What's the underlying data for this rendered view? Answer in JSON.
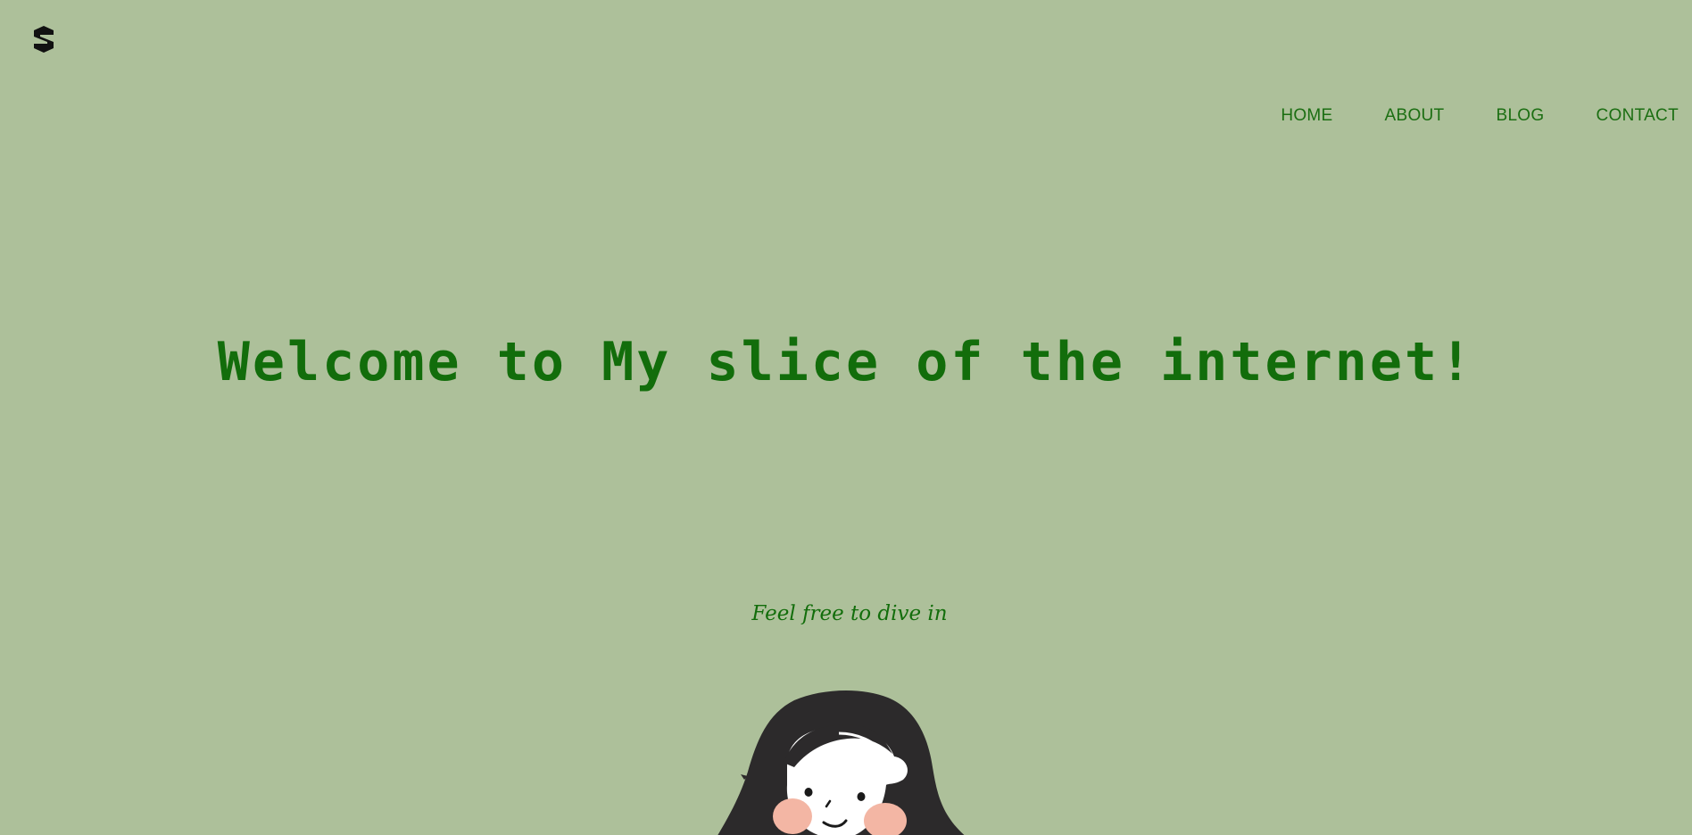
{
  "brand": {
    "logo_icon": "s-shield-logo-icon"
  },
  "nav": {
    "items": [
      {
        "label": "HOME"
      },
      {
        "label": "ABOUT"
      },
      {
        "label": "BLOG"
      },
      {
        "label": "CONTACT"
      }
    ]
  },
  "hero": {
    "title": "Welcome to My slice of the internet!",
    "subtitle": "Feel free to dive in"
  },
  "illustration": {
    "icon": "girl-portrait-illustration"
  },
  "colors": {
    "background": "#adc09a",
    "accent": "#126d0b",
    "nav_text": "#1b6e12"
  }
}
